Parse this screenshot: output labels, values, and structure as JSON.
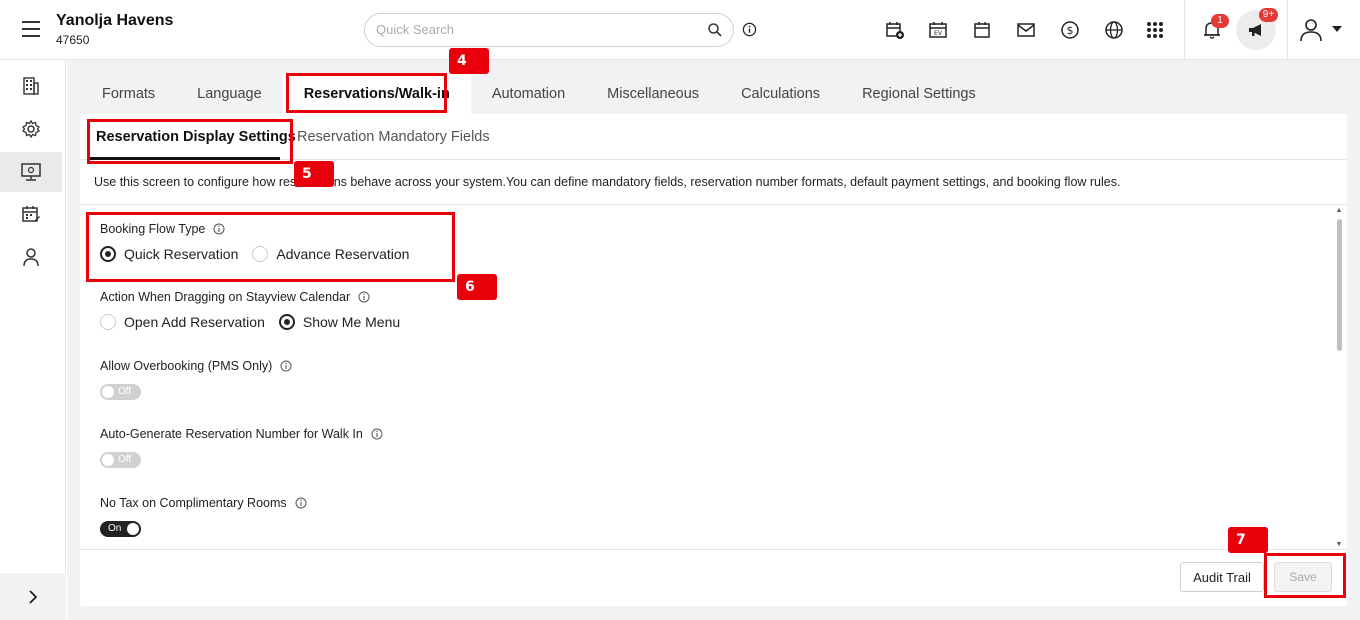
{
  "header": {
    "hotel_name": "Yanolja Havens",
    "hotel_id": "47650",
    "search_placeholder": "Quick Search",
    "notification_count": "1",
    "announcement_count": "9+"
  },
  "sidebar": {
    "items": [
      "building-icon",
      "settings-icon",
      "monitor-icon",
      "calendar-icon",
      "user-icon"
    ],
    "active_index": 2
  },
  "tabs": [
    {
      "label": "Formats"
    },
    {
      "label": "Language"
    },
    {
      "label": "Reservations/Walk-in",
      "active": true
    },
    {
      "label": "Automation"
    },
    {
      "label": "Miscellaneous"
    },
    {
      "label": "Calculations"
    },
    {
      "label": "Regional Settings"
    }
  ],
  "subtabs": [
    {
      "label": "Reservation Display Settings",
      "active": true
    },
    {
      "label": "Reservation Mandatory Fields"
    }
  ],
  "description": "Use this screen to configure how reservations behave across your system.You can define mandatory fields, reservation number formats, default payment settings, and booking flow rules.",
  "settings": {
    "booking_flow": {
      "label": "Booking Flow Type",
      "options": [
        "Quick Reservation",
        "Advance Reservation"
      ],
      "selected": "Quick Reservation"
    },
    "drag_action": {
      "label": "Action When Dragging on Stayview Calendar",
      "options": [
        "Open Add Reservation",
        "Show Me Menu"
      ],
      "selected": "Show Me Menu"
    },
    "overbooking": {
      "label": "Allow Overbooking (PMS Only)",
      "state": "Off"
    },
    "auto_generate": {
      "label": "Auto-Generate Reservation Number for Walk In",
      "state": "Off"
    },
    "no_tax": {
      "label": "No Tax on Complimentary Rooms",
      "state": "On"
    }
  },
  "footer": {
    "audit_label": "Audit Trail",
    "save_label": "Save"
  },
  "annotations": {
    "step4": "4",
    "step5": "5",
    "step6": "6",
    "step7": "7",
    "color": "#e8000b"
  }
}
